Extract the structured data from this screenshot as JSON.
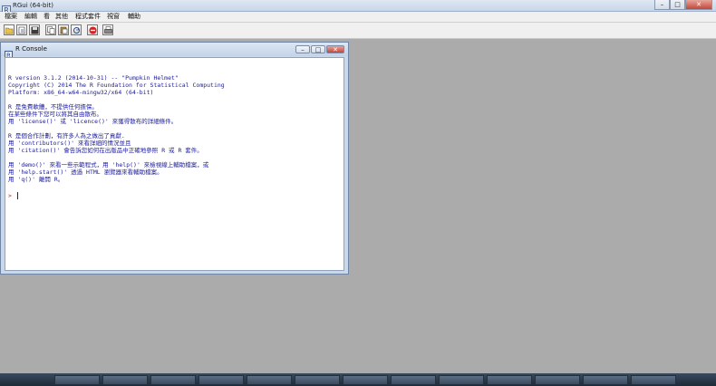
{
  "app": {
    "title": "RGui (64-bit)"
  },
  "window_controls": {
    "minimize": "–",
    "maximize": "□",
    "close": "✕"
  },
  "menu": [
    "檔案",
    "編輯",
    "看",
    "其他",
    "程式套件",
    "視窗",
    "輔助"
  ],
  "toolbar": [
    "open-script",
    "load-workspace",
    "save-workspace",
    "copy",
    "paste",
    "copy-paste",
    "stop",
    "print"
  ],
  "console": {
    "title": "R Console",
    "lines": [
      "R version 3.1.2 (2014-10-31) -- \"Pumpkin Helmet\"",
      "Copyright (C) 2014 The R Foundation for Statistical Computing",
      "Platform: x86_64-w64-mingw32/x64 (64-bit)",
      "",
      "R 是免費軟體，不提供任何擔保。",
      "在某些條件下您可以將其自由散布。",
      "用 'license()' 或 'licence()' 來獲得散布的詳細條件。",
      "",
      "R 是個合作計劃，有許多人為之做出了貢獻.",
      "用 'contributors()' 來看詳細的情況並且",
      "用 'citation()' 會告訴您如何在出版品中正確地參照 R 或 R 套件。",
      "",
      "用 'demo()' 來看一些示範程式，用 'help()' 來檢視線上輔助檔案，或",
      "用 'help.start()' 透過 HTML 瀏覽器來看輔助檔案。",
      "用 'q()' 離開 R。"
    ],
    "prompt": ">"
  },
  "colors": {
    "console_text": "#1a1a9c",
    "prompt": "#c81e1e"
  }
}
